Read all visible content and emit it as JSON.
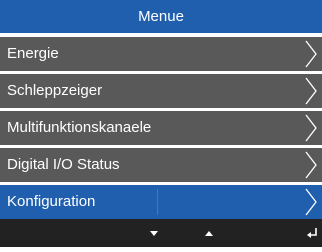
{
  "title": "Menue",
  "menu": {
    "items": [
      {
        "label": "Energie"
      },
      {
        "label": "Schleppzeiger"
      },
      {
        "label": "Multifunktionskanaele"
      },
      {
        "label": "Digital I/O Status"
      },
      {
        "label": "Konfiguration",
        "selected": true
      }
    ]
  },
  "softkeys": [
    {
      "icon": "arrow-down-icon"
    },
    {
      "icon": "arrow-up-icon"
    },
    {
      "icon": "enter-icon"
    }
  ],
  "colors": {
    "accent": "#1f5fae",
    "item_background": "#595959",
    "softkey_bar": "#222222",
    "text": "#ffffff"
  }
}
